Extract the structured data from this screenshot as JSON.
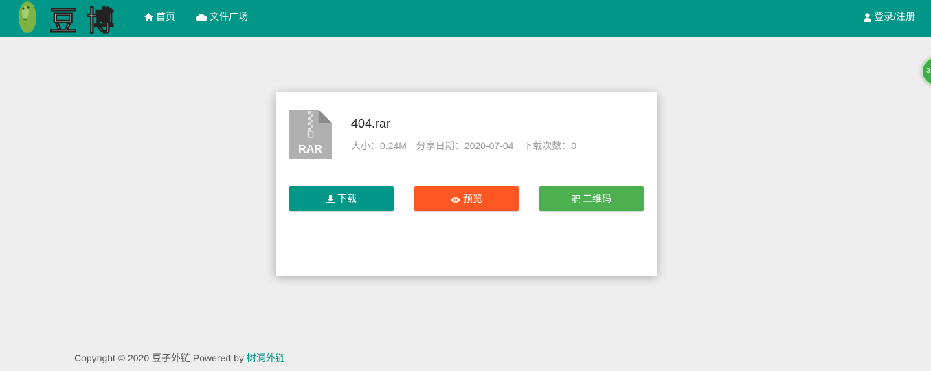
{
  "nav": {
    "home_label": "首页",
    "square_label": "文件广场",
    "login_label": "登录/注册",
    "logo_text": "豆 博"
  },
  "float_badge": "3",
  "file": {
    "name": "404.rar",
    "icon_text": "RAR",
    "size_label": "大小：0.24M",
    "date_label": "分享日期：2020-07-04",
    "downloads_label": "下载次数：0"
  },
  "buttons": {
    "download": "下载",
    "preview": "预览",
    "qrcode": "二维码"
  },
  "footer": {
    "copyright": "Copyright © 2020 豆子外链 Powered by",
    "link": "树洞外链"
  },
  "colors": {
    "topbar": "#009688",
    "download": "#009688",
    "preview": "#ff5722",
    "qrcode": "#4caf50"
  },
  "icons": [
    "home-icon",
    "cloud-icon",
    "user-icon",
    "zip-file-icon",
    "download-icon",
    "eye-icon",
    "qrcode-icon"
  ]
}
